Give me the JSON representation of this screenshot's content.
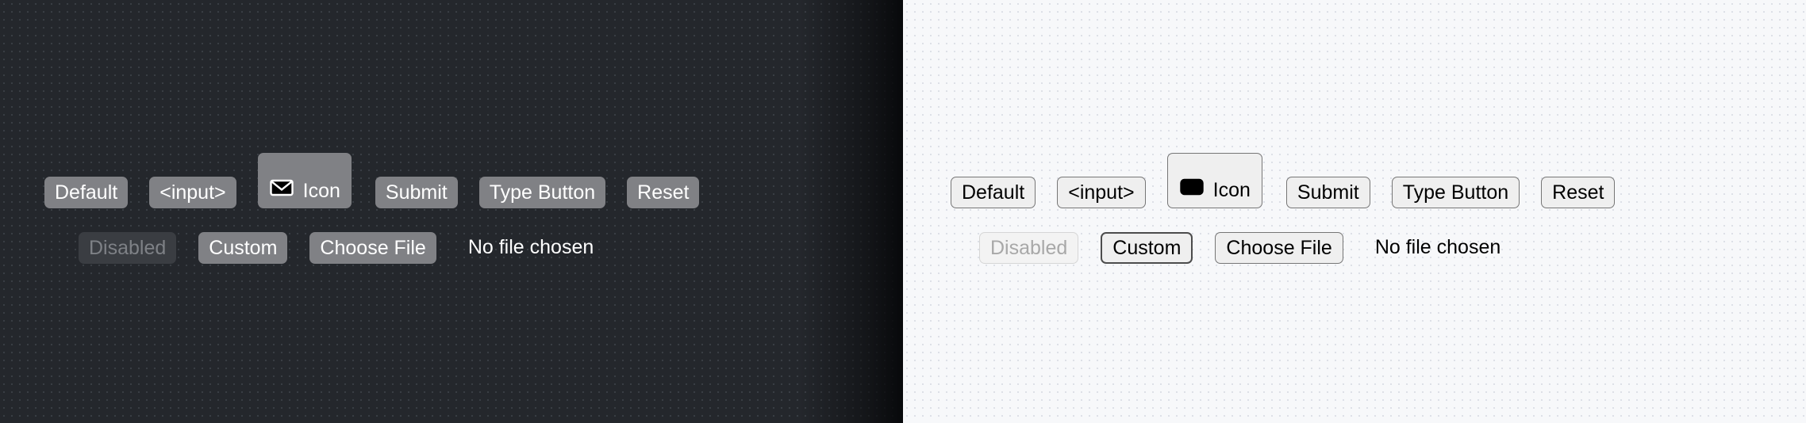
{
  "panels": [
    {
      "theme": "dark",
      "background_color": "#24272c",
      "button_fill": "#808185",
      "text_color": "#ffffff",
      "disabled_fill": "#3a3d42",
      "disabled_text": "#7e8186",
      "row1": {
        "default_label": "Default",
        "input_label": "<input>",
        "icon_label": "Icon",
        "icon_name": "envelope-icon",
        "submit_label": "Submit",
        "type_button_label": "Type Button",
        "reset_label": "Reset"
      },
      "row2": {
        "disabled_label": "Disabled",
        "custom_label": "Custom",
        "choose_file_label": "Choose File",
        "file_status": "No file chosen"
      }
    },
    {
      "theme": "light",
      "background_color": "#f7f8fa",
      "button_fill": "#efefef",
      "border_color": "#767676",
      "text_color": "#000000",
      "disabled_text": "#a8a8a8",
      "row1": {
        "default_label": "Default",
        "input_label": "<input>",
        "icon_label": "Icon",
        "icon_name": "envelope-icon",
        "submit_label": "Submit",
        "type_button_label": "Type Button",
        "reset_label": "Reset"
      },
      "row2": {
        "disabled_label": "Disabled",
        "custom_label": "Custom",
        "choose_file_label": "Choose File",
        "file_status": "No file chosen"
      }
    }
  ]
}
